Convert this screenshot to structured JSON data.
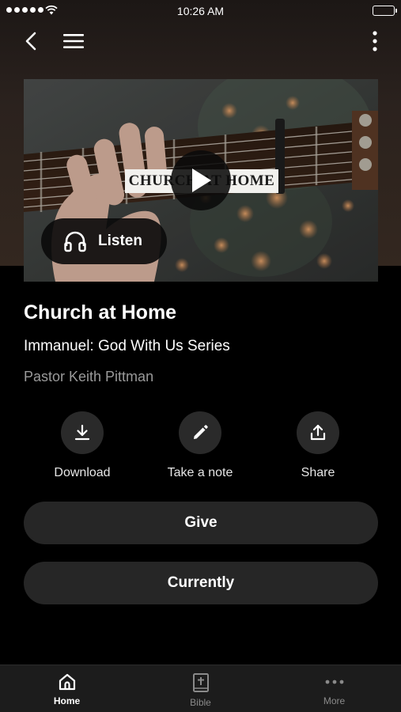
{
  "status_bar": {
    "time": "10:26 AM"
  },
  "media": {
    "caption_text": "CHURCH AT HOME",
    "listen_label": "Listen"
  },
  "content": {
    "title": "Church at Home",
    "subtitle": "Immanuel: God With Us Series",
    "speaker": "Pastor Keith Pittman"
  },
  "actions": [
    {
      "label": "Download",
      "icon": "download-icon"
    },
    {
      "label": "Take a note",
      "icon": "pencil-icon"
    },
    {
      "label": "Share",
      "icon": "share-icon"
    }
  ],
  "buttons": {
    "give": "Give",
    "currently": "Currently"
  },
  "tabbar": {
    "items": [
      {
        "label": "Home",
        "icon": "home-icon",
        "active": true
      },
      {
        "label": "Bible",
        "icon": "bible-icon",
        "active": false
      },
      {
        "label": "More",
        "icon": "more-icon",
        "active": false
      }
    ]
  },
  "colors": {
    "background": "#000000",
    "card": "#262626",
    "action_circle": "#2a2a2a",
    "tabbar": "#1c1c1c",
    "muted_text": "#9a9a9a"
  }
}
